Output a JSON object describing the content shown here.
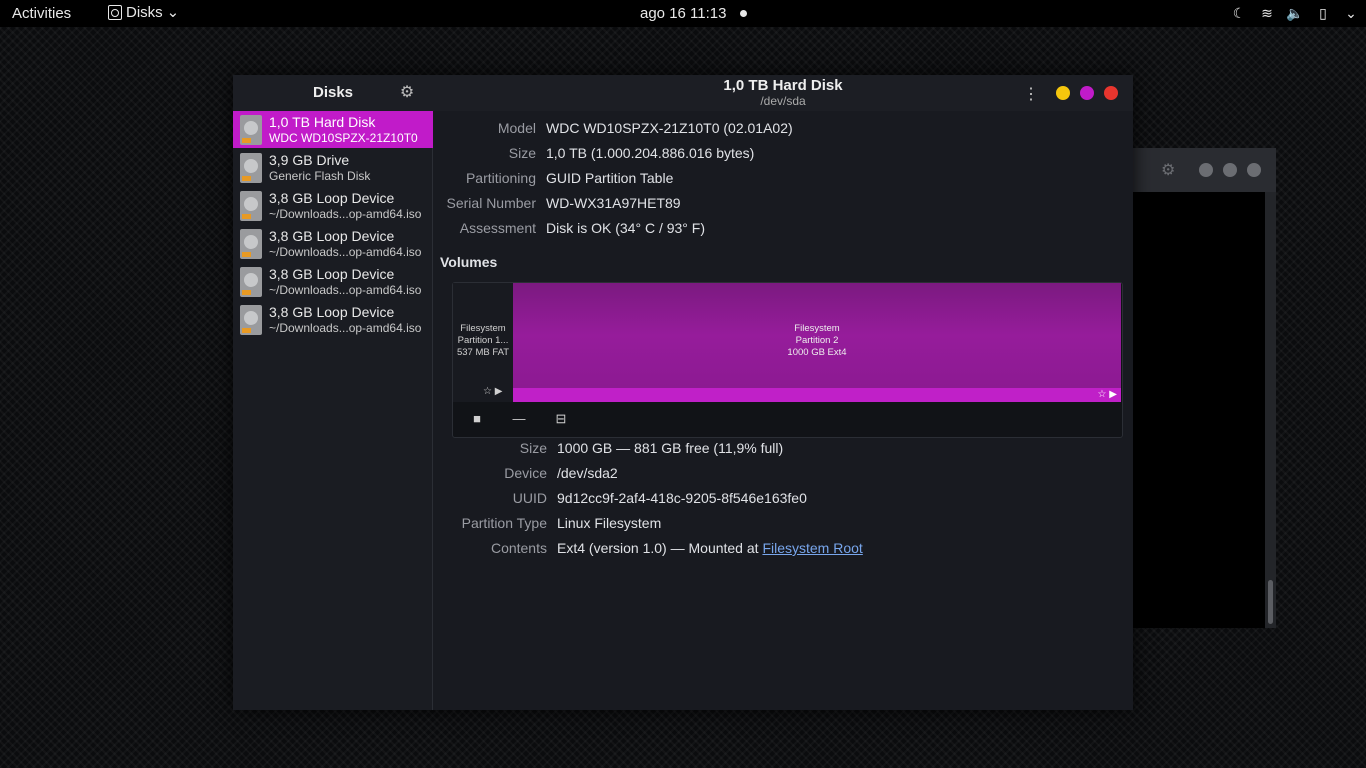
{
  "topbar": {
    "activities": "Activities",
    "app_name": "Disks",
    "clock": "ago 16  11:13"
  },
  "window": {
    "sidebar_title": "Disks",
    "title": "1,0 TB Hard Disk",
    "subtitle": "/dev/sda"
  },
  "colors": {
    "accent": "#c11bc9",
    "minimize": "#f5c60d",
    "maximize": "#c11bc9",
    "close": "#e8352e"
  },
  "sidebar": {
    "items": [
      {
        "name": "1,0 TB Hard Disk",
        "sub": "WDC WD10SPZX-21Z10T0",
        "selected": true
      },
      {
        "name": "3,9 GB Drive",
        "sub": "Generic Flash Disk"
      },
      {
        "name": "3,8 GB Loop Device",
        "sub": "~/Downloads...op-amd64.iso"
      },
      {
        "name": "3,8 GB Loop Device",
        "sub": "~/Downloads...op-amd64.iso"
      },
      {
        "name": "3,8 GB Loop Device",
        "sub": "~/Downloads...op-amd64.iso"
      },
      {
        "name": "3,8 GB Loop Device",
        "sub": "~/Downloads...op-amd64.iso"
      }
    ]
  },
  "disk": {
    "model_label": "Model",
    "model": "WDC WD10SPZX-21Z10T0 (02.01A02)",
    "size_label": "Size",
    "size": "1,0 TB (1.000.204.886.016 bytes)",
    "partitioning_label": "Partitioning",
    "partitioning": "GUID Partition Table",
    "serial_label": "Serial Number",
    "serial": "WD-WX31A97HET89",
    "assessment_label": "Assessment",
    "assessment": "Disk is OK (34° C / 93° F)"
  },
  "volumes": {
    "label": "Volumes",
    "p1": {
      "line1": "Filesystem",
      "line2": "Partition 1...",
      "line3": "537 MB FAT"
    },
    "p2": {
      "line1": "Filesystem",
      "line2": "Partition 2",
      "line3": "1000 GB Ext4"
    }
  },
  "partition": {
    "size_label": "Size",
    "size": "1000 GB — 881 GB free (11,9% full)",
    "device_label": "Device",
    "device": "/dev/sda2",
    "uuid_label": "UUID",
    "uuid": "9d12cc9f-2af4-418c-9205-8f546e163fe0",
    "type_label": "Partition Type",
    "type": "Linux Filesystem",
    "contents_label": "Contents",
    "contents_prefix": "Ext4 (version 1.0) — Mounted at ",
    "contents_link": "Filesystem Root"
  }
}
